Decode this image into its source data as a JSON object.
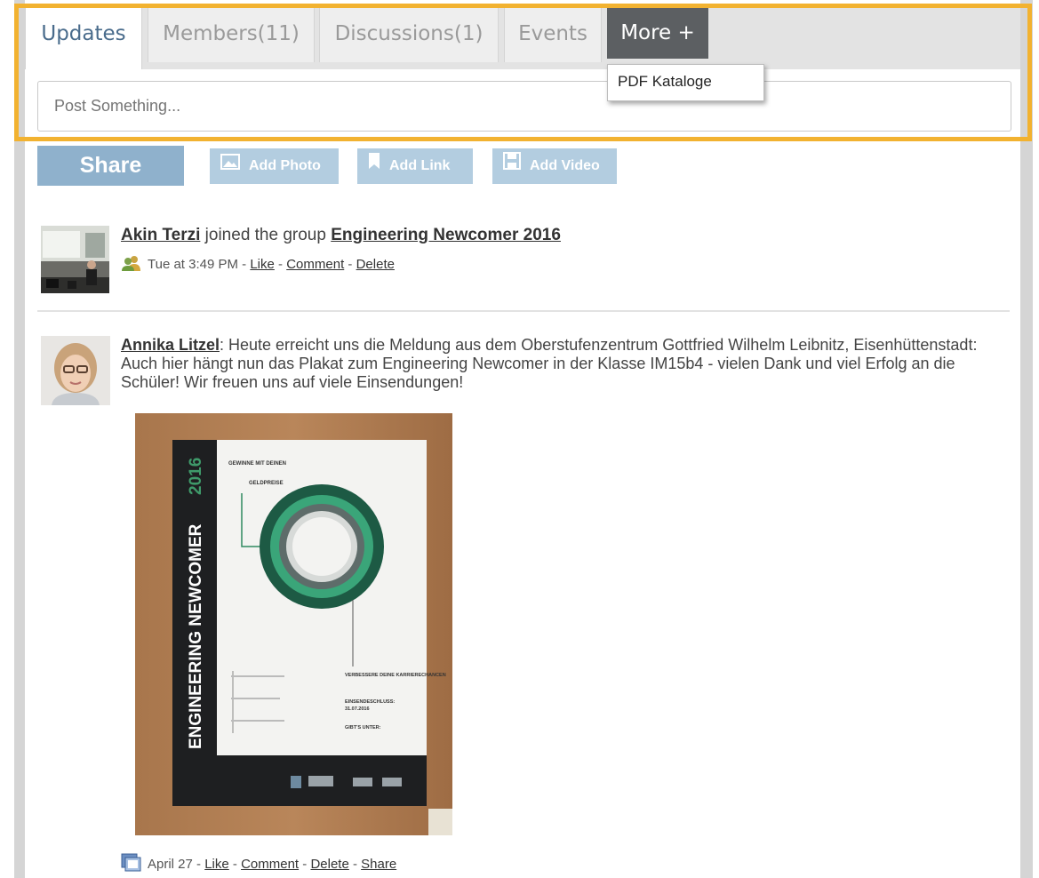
{
  "tabs": [
    {
      "label": "Updates",
      "active": true
    },
    {
      "label": "Members(11)",
      "active": false
    },
    {
      "label": "Discussions(1)",
      "active": false
    },
    {
      "label": "Events",
      "active": false
    },
    {
      "label": "More +",
      "active": false
    }
  ],
  "more_dropdown": {
    "items": [
      "PDF Kataloge"
    ]
  },
  "composer": {
    "placeholder": "Post Something..."
  },
  "toolbar": {
    "share_label": "Share",
    "add_photo_label": "Add Photo",
    "add_link_label": "Add Link",
    "add_video_label": "Add Video"
  },
  "feed": [
    {
      "author": "Akin Terzi",
      "action_text": " joined the group ",
      "group": "Engineering Newcomer 2016",
      "timestamp": "Tue at 3:49 PM",
      "actions": [
        "Like",
        "Comment",
        "Delete"
      ]
    },
    {
      "author": "Annika Litzel",
      "text": ": Heute erreicht uns die Meldung aus dem Oberstufenzentrum Gottfried Wilhelm Leibnitz, Eisenhüttenstadt: Auch hier hängt nun das Plakat zum Engineering Newcomer in der Klasse IM15b4 - vielen Dank und viel Erfolg an die Schüler! Wir freuen uns auf viele Einsendungen!",
      "timestamp": "April 27",
      "actions": [
        "Like",
        "Comment",
        "Delete",
        "Share"
      ],
      "photo": {
        "poster_title": "ENGINEERING NEWCOMER",
        "poster_year": "2016",
        "poster_items": [
          "GEWINNE MIT DEINEN",
          "GELDPREISE",
          "VERBESSERE DEINE KARRIERECHANCEN",
          "EINSENDESCHLUSS:",
          "31.07.2016",
          "GIBT'S UNTER:"
        ]
      }
    }
  ],
  "colors": {
    "highlight": "#f2b230",
    "active_tab_text": "#4a6c8c",
    "more_tab_bg": "#5c5f62",
    "share_bg": "#8fb1cc",
    "tool_bg": "#b3cde0"
  }
}
